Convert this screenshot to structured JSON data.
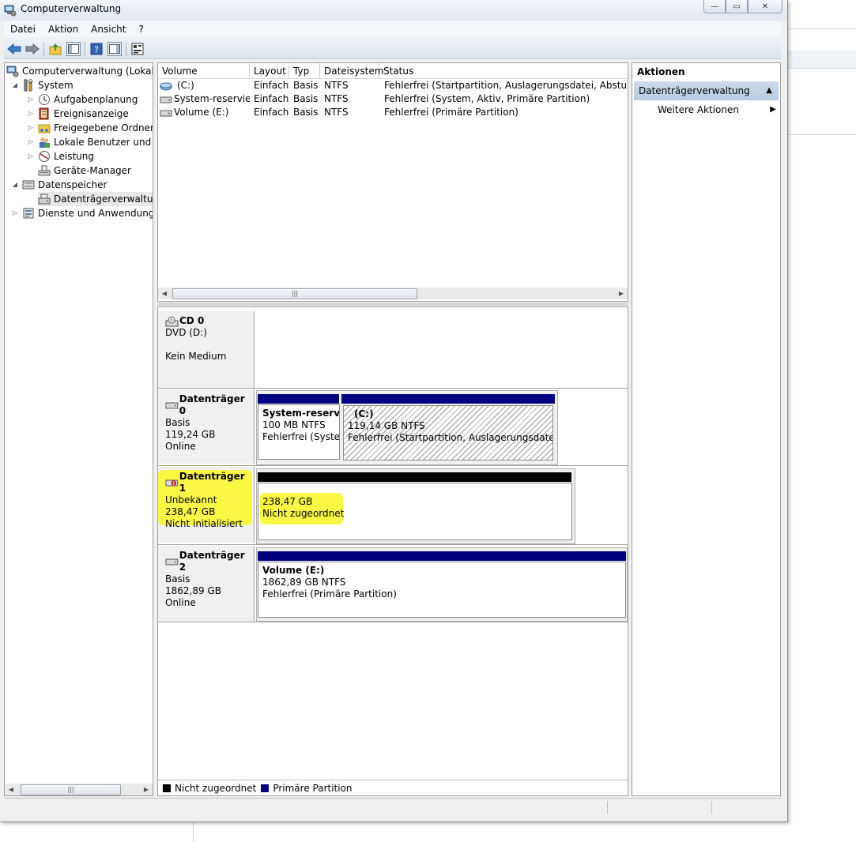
{
  "window": {
    "title": "Computerverwaltung",
    "minimize": "—",
    "maximize": "▭",
    "close": "✕"
  },
  "menu": [
    "Datei",
    "Aktion",
    "Ansicht",
    "?"
  ],
  "tree": {
    "root": "Computerverwaltung (Lokal)",
    "system": "System",
    "aufgaben": "Aufgabenplanung",
    "ereignis": "Ereignisanzeige",
    "freigaben": "Freigegebene Ordner",
    "benutzer": "Lokale Benutzer und Gruppen",
    "leistung": "Leistung",
    "geraete": "Geräte-Manager",
    "datenspeicher": "Datenspeicher",
    "datentraeger": "Datenträgerverwaltung",
    "dienste": "Dienste und Anwendungen"
  },
  "volumes": {
    "headers": [
      "Volume",
      "Layout",
      "Typ",
      "Dateisystem",
      "Status"
    ],
    "rows": [
      {
        "volume": "(C:)",
        "layout": "Einfach",
        "typ": "Basis",
        "fs": "NTFS",
        "status": "Fehlerfrei (Startpartition, Auslagerungsdatei, Absturzabbild, Primäre Partition)"
      },
      {
        "volume": "System-reserviert",
        "layout": "Einfach",
        "typ": "Basis",
        "fs": "NTFS",
        "status": "Fehlerfrei (System, Aktiv, Primäre Partition)"
      },
      {
        "volume": "Volume (E:)",
        "layout": "Einfach",
        "typ": "Basis",
        "fs": "NTFS",
        "status": "Fehlerfrei (Primäre Partition)"
      }
    ]
  },
  "disks": {
    "cd0": {
      "name": "CD 0",
      "type": "DVD (D:)",
      "state": "Kein Medium"
    },
    "d0": {
      "name": "Datenträger 0",
      "type": "Basis",
      "size": "119,24 GB",
      "state": "Online",
      "p1": {
        "name": "System-reserviert",
        "size": "100 MB NTFS",
        "status": "Fehlerfrei (System, Aktiv, Primäre Partition)"
      },
      "p2": {
        "name": "(C:)",
        "size": "119,14 GB NTFS",
        "status": "Fehlerfrei (Startpartition, Auslagerungsdatei, Absturzabbild, Primäre Partition)"
      }
    },
    "d1": {
      "name": "Datenträger 1",
      "type": "Unbekannt",
      "size": "238,47 GB",
      "state": "Nicht initialisiert",
      "p1": {
        "size": "238,47 GB",
        "status": "Nicht zugeordnet"
      }
    },
    "d2": {
      "name": "Datenträger 2",
      "type": "Basis",
      "size": "1862,89 GB",
      "state": "Online",
      "p1": {
        "name": "Volume  (E:)",
        "size": "1862,89 GB NTFS",
        "status": "Fehlerfrei (Primäre Partition)"
      }
    }
  },
  "legend": {
    "unallocated": "Nicht zugeordnet",
    "primary": "Primäre Partition"
  },
  "colors": {
    "unallocated": "#000000",
    "primary": "#000080",
    "highlight": "#fbf845",
    "action_header": "#b7cbe1"
  },
  "actions": {
    "title": "Aktionen",
    "section": "Datenträgerverwaltung",
    "more": "Weitere Aktionen"
  }
}
